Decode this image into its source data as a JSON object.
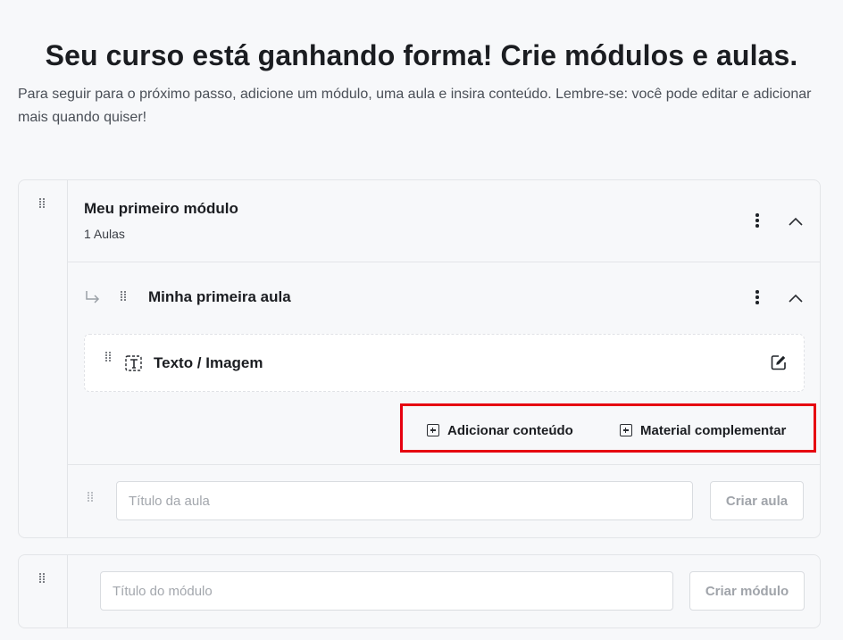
{
  "header": {
    "title": "Seu curso está ganhando forma! Crie módulos e aulas.",
    "subtitle": "Para seguir para o próximo passo, adicione um módulo, uma aula e insira conteúdo. Lembre-se: você pode editar e adicionar mais quando quiser!"
  },
  "module": {
    "title": "Meu primeiro módulo",
    "lesson_count": "1 Aulas",
    "lesson": {
      "title": "Minha primeira aula",
      "content_item": {
        "label": "Texto / Imagem",
        "icon": "text-image-icon"
      },
      "actions": {
        "add_content": "Adicionar conteúdo",
        "supplementary_material": "Material complementar"
      }
    },
    "new_lesson": {
      "placeholder": "Título da aula",
      "button": "Criar aula"
    }
  },
  "new_module": {
    "placeholder": "Título do módulo",
    "button": "Criar módulo"
  },
  "colors": {
    "highlight": "#e60010",
    "background": "#f7f8fa"
  }
}
